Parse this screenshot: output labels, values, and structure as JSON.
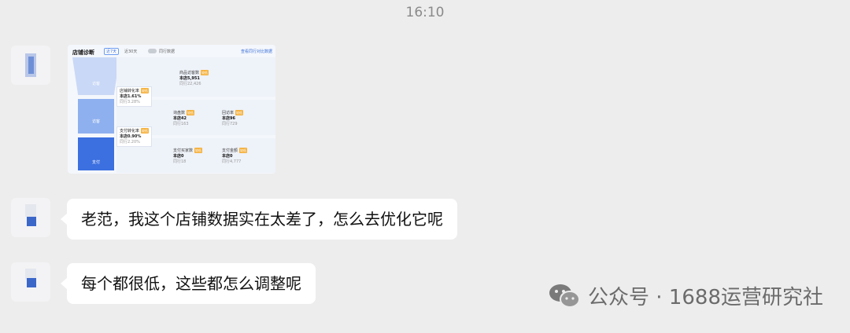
{
  "timestamp": "16:10",
  "image_message": {
    "dashboard": {
      "title": "店铺诊断",
      "range_chip": "近7天",
      "range_alt": "近30天",
      "toggle_label": "同行数据",
      "link": "查看同行对比数据",
      "funnel": [
        "访客",
        "访客",
        "支付"
      ],
      "metrics": [
        {
          "name": "商品访客数",
          "tag": "较低",
          "value": "本店5,951",
          "compare": "同行22,426"
        },
        {
          "name": "店铺转化率",
          "tag": "较低",
          "value": "本店1.61%",
          "compare": "同行3.28%"
        },
        {
          "name": "询盘数",
          "tag": "较低",
          "value": "本店42",
          "compare": "同行163"
        },
        {
          "name": "回访率",
          "tag": "较低",
          "value": "本店96",
          "compare": "同行729"
        },
        {
          "name": "支付转化率",
          "tag": "较低",
          "value": "本店0.90%",
          "compare": "同行2.20%"
        },
        {
          "name": "支付买家数",
          "tag": "较低",
          "value": "本店0",
          "compare": "同行18"
        },
        {
          "name": "支付金额",
          "tag": "较低",
          "value": "本店0",
          "compare": "同行4,777"
        }
      ]
    }
  },
  "messages": [
    {
      "text": "老范，我这个店铺数据实在太差了，怎么去优化它呢"
    },
    {
      "text": "每个都很低，这些都怎么调整呢"
    }
  ],
  "watermark": {
    "text": "公众号 · 1688运营研究社"
  },
  "colors": {
    "background": "#ededed",
    "bubble": "#ffffff",
    "accent_blue": "#3a6fd8",
    "tag_orange": "#f5b13d"
  }
}
